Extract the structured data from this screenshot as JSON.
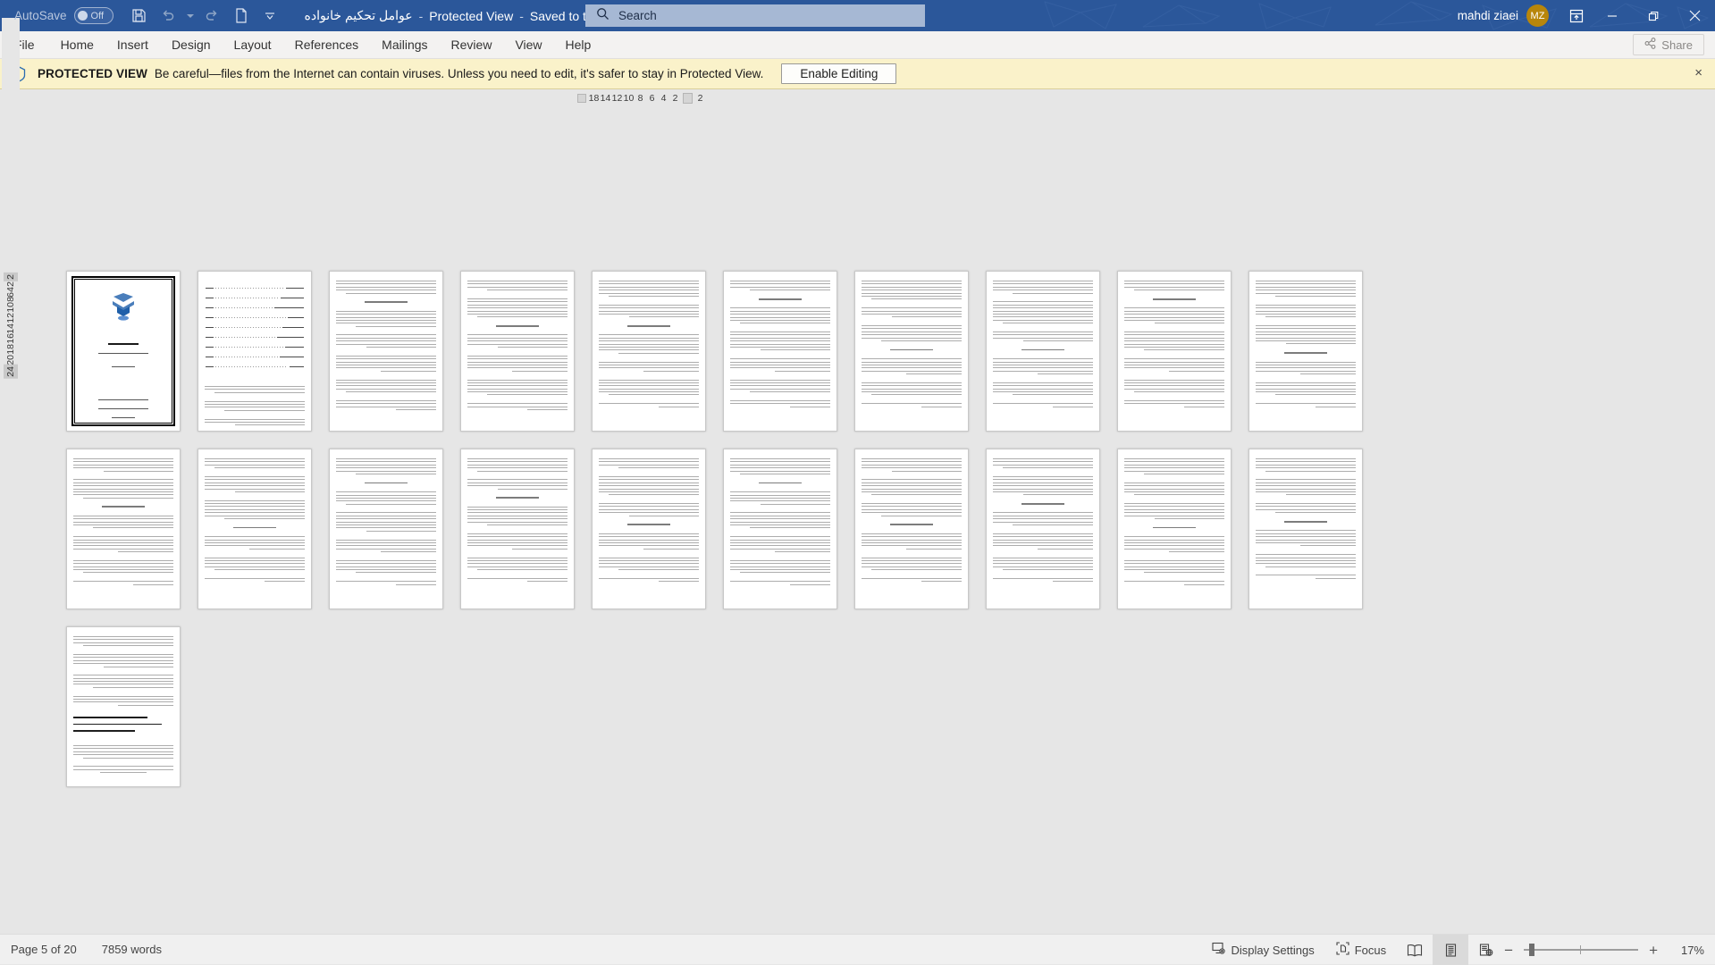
{
  "titlebar": {
    "autosave_label": "AutoSave",
    "autosave_state": "Off",
    "quick_access": [
      {
        "name": "save-icon",
        "label": "Save"
      },
      {
        "name": "undo-icon",
        "label": "Undo"
      },
      {
        "name": "undo-dropdown-icon",
        "label": "Undo options"
      },
      {
        "name": "redo-icon",
        "label": "Redo"
      },
      {
        "name": "new-document-icon",
        "label": "New"
      },
      {
        "name": "customize-quick-access-icon",
        "label": "Customize Quick Access Toolbar"
      }
    ],
    "document_name": "عوامل تحکیم خانواده",
    "protected_view_tag": "Protected View",
    "save_state": "Saved to this PC",
    "search_placeholder": "Search",
    "user_name": "mahdi ziaei",
    "avatar_initials": "MZ",
    "ribbon_display_label": "Ribbon Display Options",
    "minimize_label": "Minimize",
    "restore_label": "Restore Down",
    "close_label": "Close",
    "accent_color": "#2b579a",
    "avatar_color": "#b8860b"
  },
  "ribbon": {
    "tabs": [
      {
        "label": "File"
      },
      {
        "label": "Home"
      },
      {
        "label": "Insert"
      },
      {
        "label": "Design"
      },
      {
        "label": "Layout"
      },
      {
        "label": "References"
      },
      {
        "label": "Mailings"
      },
      {
        "label": "Review"
      },
      {
        "label": "View"
      },
      {
        "label": "Help"
      }
    ],
    "share_label": "Share"
  },
  "protected_view": {
    "title": "PROTECTED VIEW",
    "message": "Be careful—files from the Internet can contain viruses. Unless you need to edit, it's safer to stay in Protected View.",
    "button_label": "Enable Editing",
    "close_label": "×",
    "background_color": "#faf2ca"
  },
  "ruler": {
    "corner_label": "L",
    "horizontal_ticks": [
      "18",
      "14",
      "12",
      "10",
      "8",
      "6",
      "4",
      "2",
      "2"
    ],
    "vertical_ticks": [
      "2",
      "2",
      "4",
      "6",
      "8",
      "10",
      "12",
      "14",
      "16",
      "18",
      "20",
      "24"
    ]
  },
  "statusbar": {
    "page_label": "Page 5 of 20",
    "word_count": "7859 words",
    "display_settings_label": "Display Settings",
    "focus_label": "Focus",
    "view_modes": [
      {
        "name": "read-mode-icon",
        "label": "Read Mode",
        "active": false
      },
      {
        "name": "print-layout-icon",
        "label": "Print Layout",
        "active": true
      },
      {
        "name": "web-layout-icon",
        "label": "Web Layout",
        "active": false
      }
    ],
    "zoom_out_label": "−",
    "zoom_in_label": "+",
    "zoom_level": "17%"
  },
  "document": {
    "total_pages_shown": 20,
    "zoom_percent": 17,
    "pages_per_row": 10
  }
}
